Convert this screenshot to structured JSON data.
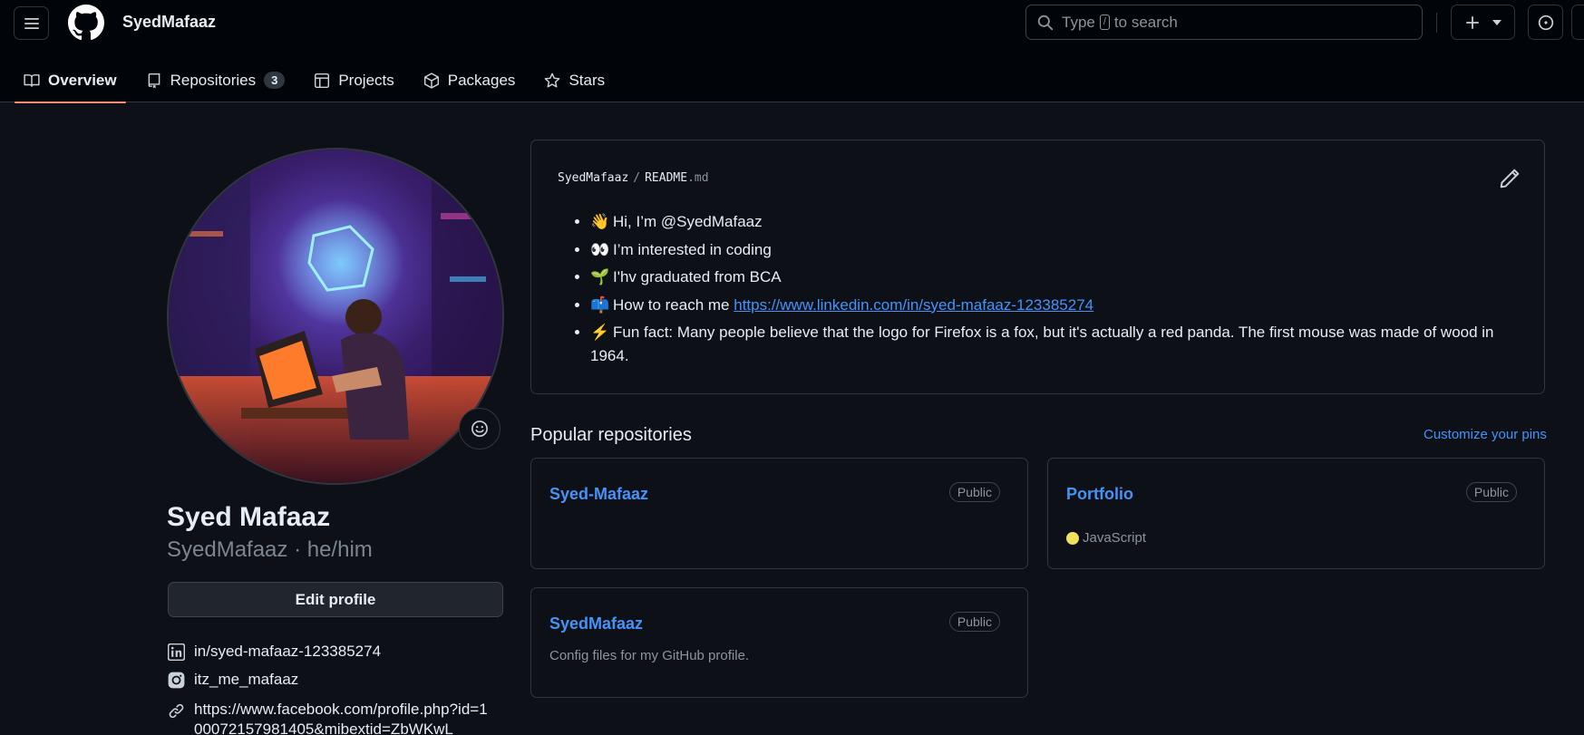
{
  "header": {
    "username": "SyedMafaaz",
    "search_prefix": "Type",
    "search_key": "/",
    "search_suffix": "to search"
  },
  "tabs": [
    {
      "label": "Overview"
    },
    {
      "label": "Repositories",
      "count": "3"
    },
    {
      "label": "Projects"
    },
    {
      "label": "Packages"
    },
    {
      "label": "Stars"
    }
  ],
  "profile": {
    "full_name": "Syed Mafaaz",
    "login_line": "SyedMafaaz · he/him",
    "edit_label": "Edit profile",
    "linkedin": "in/syed-mafaaz-123385274",
    "instagram": "itz_me_mafaaz",
    "facebook": "https://www.facebook.com/profile.php?id=100072157981405&mibextid=ZbWKwL"
  },
  "readme": {
    "owner": "SyedMafaaz",
    "file": "README",
    "ext": ".md",
    "items": [
      {
        "emoji": "👋",
        "text": "Hi, I’m @SyedMafaaz"
      },
      {
        "emoji": "👀",
        "text": "I’m interested in coding"
      },
      {
        "emoji": "🌱",
        "text": "I'hv graduated from BCA"
      },
      {
        "emoji": "📫",
        "text": "How to reach me ",
        "link": "https://www.linkedin.com/in/syed-mafaaz-123385274"
      },
      {
        "emoji": "⚡",
        "text": "Fun fact: Many people believe that the logo for Firefox is a fox, but it's actually a red panda. The first mouse was made of wood in 1964."
      }
    ]
  },
  "popular": {
    "title": "Popular repositories",
    "customize_label": "Customize your pins",
    "repos": [
      {
        "name": "Syed-Mafaaz",
        "visibility": "Public"
      },
      {
        "name": "Portfolio",
        "visibility": "Public",
        "language": "JavaScript",
        "language_color": "#f1e05a"
      },
      {
        "name": "SyedMafaaz",
        "visibility": "Public",
        "description": "Config files for my GitHub profile."
      }
    ]
  },
  "colors": {
    "accent": "#4493f8",
    "tab_underline": "#fd8c73",
    "background": "#0d1117"
  }
}
